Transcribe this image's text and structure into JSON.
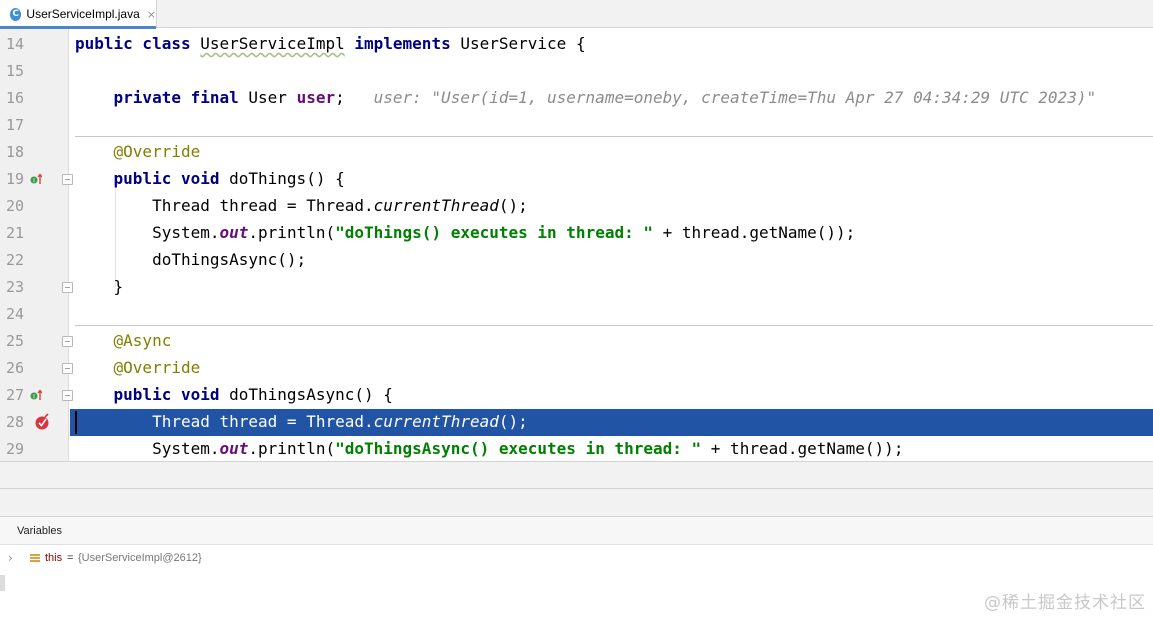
{
  "tab": {
    "icon": "java-class-icon",
    "icon_letter": "C",
    "title": "UserServiceImpl.java",
    "close": "×"
  },
  "code_lines": [
    {
      "num": "14",
      "tokens": [
        {
          "t": "public class ",
          "c": "kw"
        },
        {
          "t": "UserServiceImpl",
          "c": "wavy"
        },
        {
          "t": " "
        },
        {
          "t": "implements ",
          "c": "kw"
        },
        {
          "t": "UserService {"
        }
      ]
    },
    {
      "num": "15",
      "tokens": []
    },
    {
      "num": "16",
      "tokens": [
        {
          "t": "    "
        },
        {
          "t": "private final ",
          "c": "kw"
        },
        {
          "t": "User "
        },
        {
          "t": "user",
          "c": "fld"
        },
        {
          "t": ";   "
        },
        {
          "t": "user: \"User(id=1, username=oneby, createTime=Thu Apr 27 04:34:29 UTC 2023)\"",
          "c": "hint"
        }
      ]
    },
    {
      "num": "17",
      "tokens": []
    },
    {
      "num": "18",
      "tokens": [
        {
          "t": "    "
        },
        {
          "t": "@Override",
          "c": "ann"
        }
      ]
    },
    {
      "num": "19",
      "gutter": "impl",
      "fold": true,
      "tokens": [
        {
          "t": "    "
        },
        {
          "t": "public void ",
          "c": "kw"
        },
        {
          "t": "doThings() {"
        }
      ]
    },
    {
      "num": "20",
      "tokens": [
        {
          "t": "        Thread thread = Thread."
        },
        {
          "t": "currentThread",
          "c": "ital"
        },
        {
          "t": "();"
        }
      ]
    },
    {
      "num": "21",
      "tokens": [
        {
          "t": "        System."
        },
        {
          "t": "out",
          "c": "sfld"
        },
        {
          "t": ".println("
        },
        {
          "t": "\"doThings() executes in thread: \"",
          "c": "str"
        },
        {
          "t": " + thread.getName());"
        }
      ]
    },
    {
      "num": "22",
      "tokens": [
        {
          "t": "        doThingsAsync();"
        }
      ]
    },
    {
      "num": "23",
      "fold": true,
      "tokens": [
        {
          "t": "    }"
        }
      ]
    },
    {
      "num": "24",
      "tokens": []
    },
    {
      "num": "25",
      "fold": true,
      "tokens": [
        {
          "t": "    "
        },
        {
          "t": "@Async",
          "c": "ann"
        }
      ]
    },
    {
      "num": "26",
      "fold": true,
      "tokens": [
        {
          "t": "    "
        },
        {
          "t": "@Override",
          "c": "ann"
        }
      ]
    },
    {
      "num": "27",
      "gutter": "impl",
      "fold": true,
      "tokens": [
        {
          "t": "    "
        },
        {
          "t": "public void ",
          "c": "kw"
        },
        {
          "t": "doThingsAsync() {"
        }
      ]
    },
    {
      "num": "28",
      "gutter": "breakpoint",
      "highlight": true,
      "tokens": [
        {
          "t": "        Thread thread = Thread."
        },
        {
          "t": "currentThread",
          "c": "ital"
        },
        {
          "t": "();"
        }
      ]
    },
    {
      "num": "29",
      "tokens": [
        {
          "t": "        System."
        },
        {
          "t": "out",
          "c": "sfld"
        },
        {
          "t": ".println("
        },
        {
          "t": "\"doThingsAsync() executes in thread: \"",
          "c": "str"
        },
        {
          "t": " + thread.getName());"
        }
      ]
    }
  ],
  "colors": {
    "highlight": "#2154a5",
    "keyword": "#000080",
    "string": "#008000",
    "annotation": "#808000",
    "field": "#660e7a"
  },
  "variables": {
    "title": "Variables",
    "rows": [
      {
        "icon": "object-icon",
        "name": "this",
        "eq": "=",
        "value": "{UserServiceImpl@2612}"
      }
    ]
  },
  "watermark": "@稀土掘金技术社区"
}
